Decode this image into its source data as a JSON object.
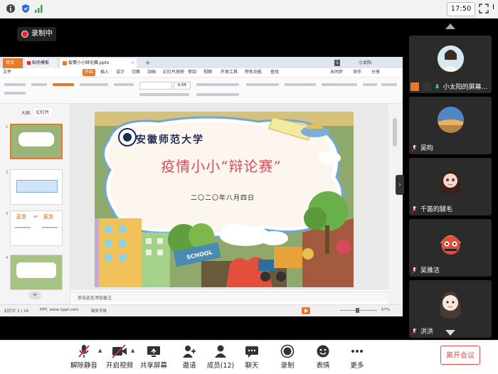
{
  "system": {
    "time": "17:50",
    "edge_label": "I"
  },
  "recording": {
    "label": "录制中"
  },
  "wps": {
    "tabs": [
      "首页",
      "稻壳模板",
      "疫情小小辩论赛.pptx"
    ],
    "user": "小太阳",
    "menus": [
      "文件",
      "开始",
      "插入",
      "设计",
      "切换",
      "动画",
      "幻灯片放映",
      "审阅",
      "视图",
      "开发工具",
      "特色功能",
      "查找"
    ],
    "menu_right": [
      "未同步",
      "协作",
      "分享"
    ],
    "panel_tabs": [
      "大纲",
      "幻灯片"
    ],
    "font_size_value": "0.05",
    "notes_placeholder": "单击此处添加备注",
    "status_left": "幻灯片 1 / 14",
    "status_theme": "PPT, www.1ppt.com",
    "status_font": "缺失字体",
    "zoom": "57%",
    "thumb_numbers": [
      "1",
      "2",
      "3",
      "4"
    ],
    "thumb3_left": "正方",
    "thumb3_vs": "vs",
    "thumb3_right": "反方"
  },
  "slide": {
    "university": "安徽师范大学",
    "title": "疫情小小“辩论赛”",
    "date": "二〇二〇年八月四日",
    "sign": "SCHOOL"
  },
  "participants": [
    {
      "name": "小太阳的屏幕...",
      "mic": "on"
    },
    {
      "name": "吴昀",
      "mic": "muted"
    },
    {
      "name": "千笛的腿毛",
      "mic": "muted"
    },
    {
      "name": "吴雅洁",
      "mic": "muted"
    },
    {
      "name": "洪洪",
      "mic": "muted"
    }
  ],
  "toolbar": {
    "unmute": "解除静音",
    "video": "开启视频",
    "share": "共享屏幕",
    "invite": "邀请",
    "members": "成员(12)",
    "chat": "聊天",
    "record": "录制",
    "emoji": "表情",
    "more": "更多",
    "leave": "离开会议"
  },
  "colors": {
    "accent_red": "#e24a4a",
    "wps_orange": "#e8782a",
    "slide_title": "#d84a5a"
  }
}
